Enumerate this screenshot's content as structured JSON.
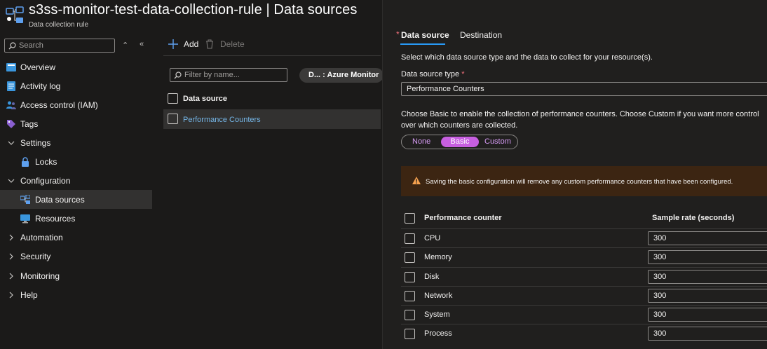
{
  "header": {
    "title": "s3ss-monitor-test-data-collection-rule | Data sources",
    "subtitle": "Data collection rule"
  },
  "sidebar": {
    "search_placeholder": "Search",
    "collapse_up": "⌃",
    "collapse_left": "«",
    "items": [
      {
        "label": "Overview"
      },
      {
        "label": "Activity log"
      },
      {
        "label": "Access control (IAM)"
      },
      {
        "label": "Tags"
      },
      {
        "label": "Settings"
      },
      {
        "label": "Locks"
      },
      {
        "label": "Configuration"
      },
      {
        "label": "Data sources"
      },
      {
        "label": "Resources"
      },
      {
        "label": "Automation"
      },
      {
        "label": "Security"
      },
      {
        "label": "Monitoring"
      },
      {
        "label": "Help"
      }
    ]
  },
  "list": {
    "add_label": "Add",
    "delete_label": "Delete",
    "filter_placeholder": "Filter by name...",
    "pill_label": "D... : Azure Monitor",
    "column_header": "Data source",
    "rows": [
      "Performance Counters"
    ]
  },
  "panel": {
    "tabs": [
      {
        "label": "Data source",
        "required": "*"
      },
      {
        "label": "Destination"
      }
    ],
    "description": "Select which data source type and the data to collect for your resource(s).",
    "type_label": "Data source type",
    "type_required": "*",
    "type_value": "Performance Counters",
    "choose_text": "Choose Basic to enable the collection of performance counters. Choose Custom if you want more control over which counters are collected.",
    "options": [
      "None",
      "Basic",
      "Custom"
    ],
    "selected_option": "Basic",
    "warning": "Saving the basic configuration will remove any custom performance counters that have been configured.",
    "table": {
      "col1": "Performance counter",
      "col2": "Sample rate (seconds)",
      "rows": [
        {
          "name": "CPU",
          "rate": "300"
        },
        {
          "name": "Memory",
          "rate": "300"
        },
        {
          "name": "Disk",
          "rate": "300"
        },
        {
          "name": "Network",
          "rate": "300"
        },
        {
          "name": "System",
          "rate": "300"
        },
        {
          "name": "Process",
          "rate": "300"
        }
      ]
    }
  },
  "colors": {
    "accent": "#2899f5",
    "link": "#75b6e7",
    "toggle": "#c75fe0",
    "warning_bg": "#3c2512",
    "warning_icon": "#f7a24f"
  }
}
